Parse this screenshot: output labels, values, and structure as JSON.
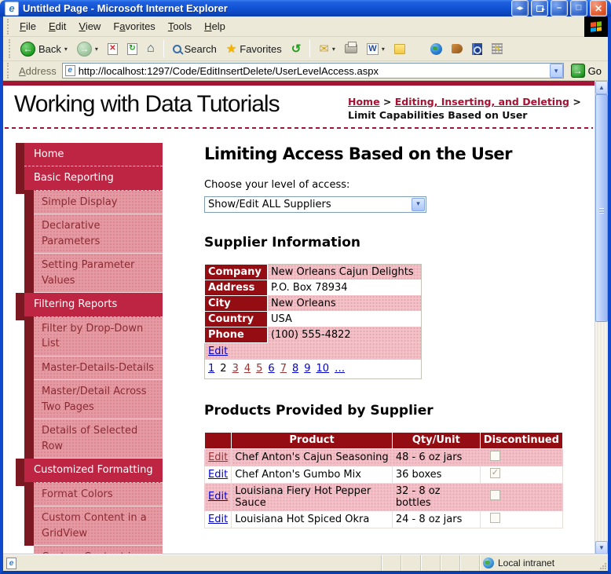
{
  "colors": {
    "accent_bar": "#a31535",
    "accent_crimson": "#be2543",
    "accent_maroon": "#7c1822",
    "pink": "#e59aa3",
    "table_header": "#930d12",
    "table_pink": "#f3c1c8",
    "link_blue": "#0000cc",
    "link_visited": "#993333",
    "breadcrumb_link": "#a61232"
  },
  "icons": {
    "ie_e": "e",
    "split": "◀▶",
    "minimize": "–",
    "maximize": "□",
    "close": "✕",
    "back": "←",
    "forward": "→",
    "stop": "✕",
    "refresh": "↻",
    "home": "⌂",
    "history": "↺",
    "mail": "✉",
    "word": "W",
    "caret": "▾",
    "combo_arrow": "▾",
    "select_arrow": "▾",
    "go_arrow": "→",
    "lightning": "ϟ",
    "scroll_up": "▲",
    "scroll_down": "▼"
  },
  "titlebar": {
    "title": "Untitled Page - Microsoft Internet Explorer"
  },
  "menubar": {
    "items": [
      {
        "u": "F",
        "rest": "ile"
      },
      {
        "u": "E",
        "rest": "dit"
      },
      {
        "u": "V",
        "rest": "iew"
      },
      {
        "pre": "F",
        "u": "a",
        "rest": "vorites"
      },
      {
        "u": "T",
        "rest": "ools"
      },
      {
        "u": "H",
        "rest": "elp"
      }
    ]
  },
  "toolbar": {
    "back_label": "Back",
    "search_label": "Search",
    "favorites_label": "Favorites"
  },
  "addressbar": {
    "label_u": "A",
    "label_rest": "ddress",
    "url": "http://localhost:1297/Code/EditInsertDelete/UserLevelAccess.aspx",
    "go_label": "Go"
  },
  "header": {
    "site_title": "Working with Data Tutorials",
    "breadcrumb": {
      "home": "Home",
      "sep1": ">",
      "section": "Editing, Inserting, and Deleting",
      "sep2": ">",
      "current": "Limit Capabilities Based on User"
    }
  },
  "sidebar": {
    "items": [
      {
        "label": "Home",
        "cls": "l1"
      },
      {
        "label": "Basic Reporting",
        "cls": "l1"
      },
      {
        "label": "Simple Display",
        "cls": "l2"
      },
      {
        "label": "Declarative Parameters",
        "cls": "l2"
      },
      {
        "label": "Setting Parameter Values",
        "cls": "l2"
      },
      {
        "label": "Filtering Reports",
        "cls": "l1"
      },
      {
        "label": "Filter by Drop-Down List",
        "cls": "l2"
      },
      {
        "label": "Master-Details-Details",
        "cls": "l2"
      },
      {
        "label": "Master/Detail Across Two Pages",
        "cls": "l2"
      },
      {
        "label": "Details of Selected Row",
        "cls": "l2"
      },
      {
        "label": "Customized Formatting",
        "cls": "l1"
      },
      {
        "label": "Format Colors",
        "cls": "l2"
      },
      {
        "label": "Custom Content in a GridView",
        "cls": "l2"
      },
      {
        "label": "Custom Content in a",
        "cls": "l2",
        "clipped": true
      }
    ]
  },
  "main": {
    "page_title": "Limiting Access Based on the User",
    "access_label": "Choose your level of access:",
    "access_value": "Show/Edit ALL Suppliers",
    "supplier": {
      "title": "Supplier Information",
      "fields": [
        {
          "label": "Company",
          "value": "New Orleans Cajun Delights"
        },
        {
          "label": "Address",
          "value": "P.O. Box 78934"
        },
        {
          "label": "City",
          "value": "New Orleans"
        },
        {
          "label": "Country",
          "value": "USA"
        },
        {
          "label": "Phone",
          "value": "(100) 555-4822"
        }
      ],
      "edit_label": "Edit",
      "pager": [
        {
          "t": "1",
          "cls": "pg-lnk"
        },
        {
          "t": "2",
          "cls": "pg-cur"
        },
        {
          "t": "3",
          "cls": "pg-vis"
        },
        {
          "t": "4",
          "cls": "pg-vis"
        },
        {
          "t": "5",
          "cls": "pg-vis"
        },
        {
          "t": "6",
          "cls": "pg-lnk"
        },
        {
          "t": "7",
          "cls": "pg-vis"
        },
        {
          "t": "8",
          "cls": "pg-lnk"
        },
        {
          "t": "9",
          "cls": "pg-lnk"
        },
        {
          "t": "10",
          "cls": "pg-lnk"
        },
        {
          "t": "…",
          "cls": "pg-lnk"
        }
      ]
    },
    "products": {
      "title": "Products Provided by Supplier",
      "columns": [
        "",
        "Product",
        "Qty/Unit",
        "Discontinued"
      ],
      "rows": [
        {
          "edit": "Edit",
          "ecls": "e-vis",
          "product": "Chef Anton's Cajun Seasoning",
          "qty": "48 - 6 oz jars",
          "checked": false
        },
        {
          "edit": "Edit",
          "ecls": "e-lnk",
          "product": "Chef Anton's Gumbo Mix",
          "qty": "36 boxes",
          "checked": true
        },
        {
          "edit": "Edit",
          "ecls": "e-lnk",
          "product": "Louisiana Fiery Hot Pepper Sauce",
          "qty": "32 - 8 oz bottles",
          "checked": false
        },
        {
          "edit": "Edit",
          "ecls": "e-lnk",
          "product": "Louisiana Hot Spiced Okra",
          "qty": "24 - 8 oz jars",
          "checked": false
        }
      ]
    }
  },
  "statusbar": {
    "zone": "Local intranet"
  }
}
